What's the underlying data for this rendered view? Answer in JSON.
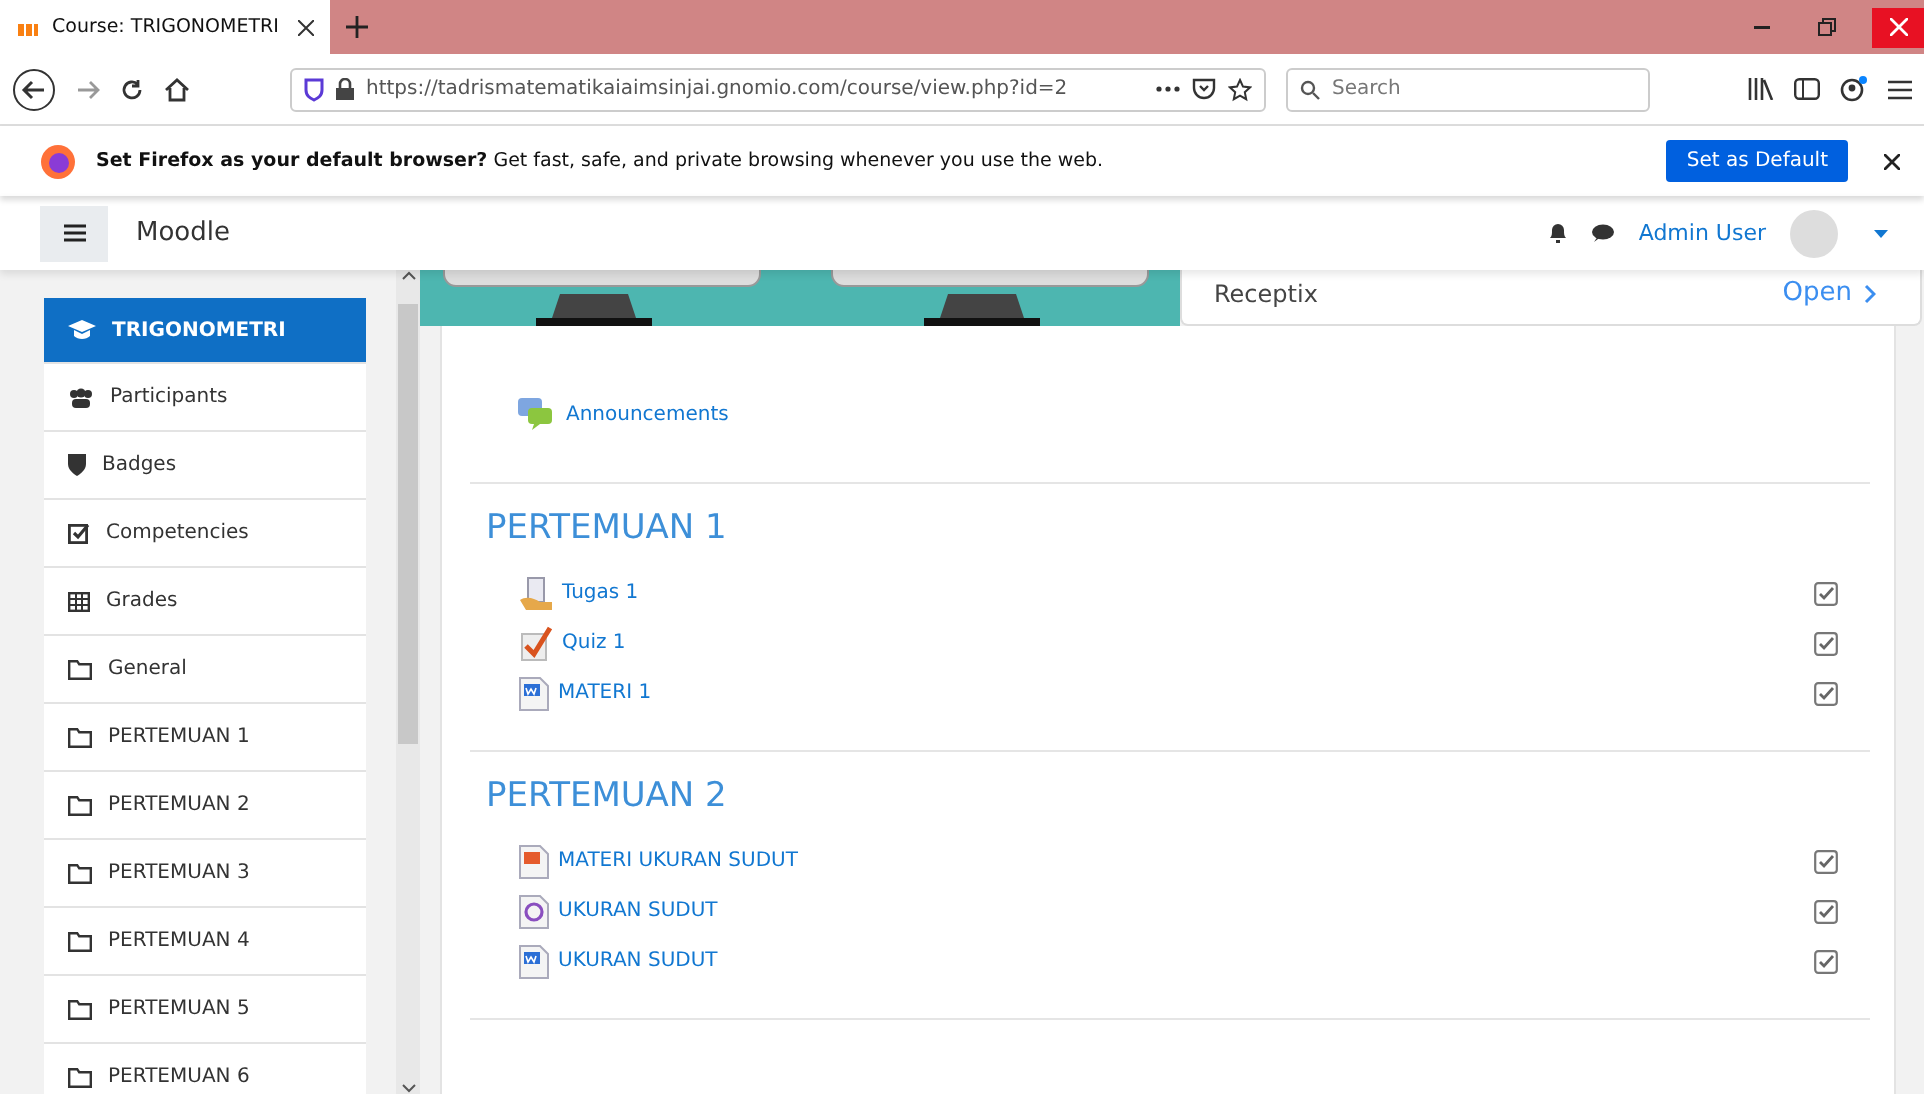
{
  "browser": {
    "tab_title": "Course: TRIGONOMETRI",
    "url": "https://tadrismatematikaiaimsinjai.gnomio.com/course/view.php?id=2",
    "search_placeholder": "Search"
  },
  "notification": {
    "bold": "Set Firefox as your default browser?",
    "text": "Get fast, safe, and private browsing whenever you use the web.",
    "button": "Set as Default"
  },
  "header": {
    "site_name": "Moodle",
    "user": "Admin User"
  },
  "sidebar": {
    "items": [
      {
        "kind": "course",
        "label": "TRIGONOMETRI",
        "selected": true
      },
      {
        "kind": "participants",
        "label": "Participants",
        "selected": false
      },
      {
        "kind": "badges",
        "label": "Badges",
        "selected": false
      },
      {
        "kind": "competencies",
        "label": "Competencies",
        "selected": false
      },
      {
        "kind": "grades",
        "label": "Grades",
        "selected": false
      },
      {
        "kind": "folder",
        "label": "General",
        "selected": false
      },
      {
        "kind": "folder",
        "label": "PERTEMUAN 1",
        "selected": false
      },
      {
        "kind": "folder",
        "label": "PERTEMUAN 2",
        "selected": false
      },
      {
        "kind": "folder",
        "label": "PERTEMUAN 3",
        "selected": false
      },
      {
        "kind": "folder",
        "label": "PERTEMUAN 4",
        "selected": false
      },
      {
        "kind": "folder",
        "label": "PERTEMUAN 5",
        "selected": false
      },
      {
        "kind": "folder",
        "label": "PERTEMUAN 6",
        "selected": false
      }
    ]
  },
  "ad": {
    "name": "Receptix",
    "link": "Open"
  },
  "announcements": {
    "label": "Announcements"
  },
  "sections": [
    {
      "title": "PERTEMUAN 1",
      "activities": [
        {
          "kind": "assign",
          "label": "Tugas 1",
          "checked": true
        },
        {
          "kind": "quiz",
          "label": "Quiz 1",
          "checked": true
        },
        {
          "kind": "word",
          "label": "MATERI 1",
          "checked": true
        }
      ]
    },
    {
      "title": "PERTEMUAN 2",
      "activities": [
        {
          "kind": "ppt",
          "label": "MATERI UKURAN SUDUT",
          "checked": true
        },
        {
          "kind": "media",
          "label": "UKURAN SUDUT",
          "checked": true
        },
        {
          "kind": "word",
          "label": "UKURAN SUDUT",
          "checked": true
        }
      ]
    }
  ]
}
